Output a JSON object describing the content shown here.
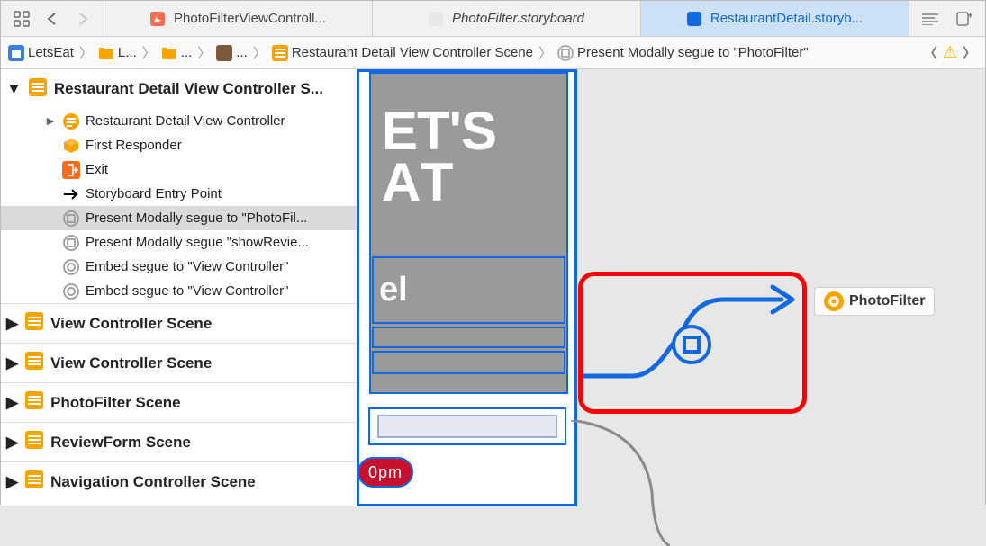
{
  "tabs": {
    "t1": "PhotoFilterViewControll...",
    "t2": "PhotoFilter.storyboard",
    "t3": "RestaurantDetail.storyb..."
  },
  "crumbs": {
    "c1": "LetsEat",
    "c2": "L...",
    "c3": "...",
    "c4": "...",
    "c5": "Restaurant Detail View Controller Scene",
    "c6": "Present Modally segue to \"PhotoFilter\""
  },
  "tree": {
    "scene1": "Restaurant Detail View Controller S...",
    "items": {
      "i1": "Restaurant Detail View Controller",
      "i2": "First Responder",
      "i3": "Exit",
      "i4": "Storyboard Entry Point",
      "i5": "Present Modally segue to \"PhotoFil...",
      "i6": "Present Modally segue \"showRevie...",
      "i7": "Embed segue to \"View Controller\"",
      "i8": "Embed segue to \"View Controller\""
    },
    "scene2": "View Controller Scene",
    "scene3": "View Controller Scene",
    "scene4": "PhotoFilter Scene",
    "scene5": "ReviewForm Scene",
    "scene6": "Navigation Controller Scene"
  },
  "canvas": {
    "bigline1": "ET'S",
    "bigline2": "AT",
    "el": "el",
    "pill": "0pm",
    "pf": "PhotoFilter"
  }
}
